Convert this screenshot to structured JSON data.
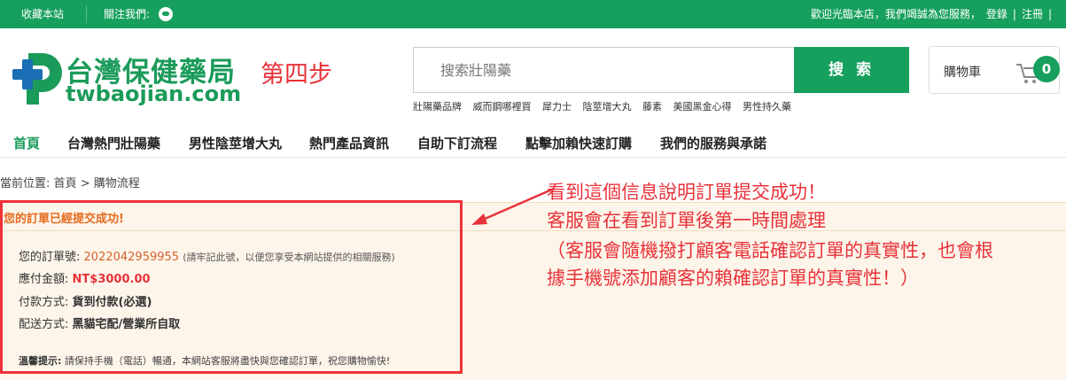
{
  "topbar": {
    "favorite": "收藏本站",
    "follow": "關注我們:",
    "welcome": "歡迎光臨本店，我們竭誠為您服務，",
    "login": "登錄",
    "sep": "|",
    "register": "注冊",
    "sep2": "|"
  },
  "logo": {
    "title": "台灣保健藥局",
    "subtitle": "twbaojian.com"
  },
  "step_label": "第四步",
  "search": {
    "placeholder": "搜索壯陽藥",
    "button": "搜 索"
  },
  "hotwords": [
    "壯陽藥品牌",
    "威而鋼哪裡買",
    "犀力士",
    "陰莖增大丸",
    "藤素",
    "美國黑金心得",
    "男性持久藥"
  ],
  "cart": {
    "label": "購物車",
    "count": "0"
  },
  "nav": [
    "首頁",
    "台灣熱門壯陽藥",
    "男性陰莖增大丸",
    "熱門產品資訊",
    "自助下訂流程",
    "點擊加賴快速訂購",
    "我們的服務與承諾"
  ],
  "breadcrumb": {
    "prefix": "當前位置:",
    "home": "首頁",
    "arrow": ">",
    "current": "購物流程"
  },
  "order": {
    "success": "您的訂單已經提交成功!",
    "number_label": "您的訂單號:",
    "number": "2022042959955",
    "number_note": "(請牢記此號，以便您享受本網站提供的相關服務)",
    "amount_label": "應付金額:",
    "amount": "NT$3000.00",
    "payment_label": "付款方式:",
    "payment": "貨到付款(必選)",
    "shipping_label": "配送方式:",
    "shipping": "黑貓宅配/營業所自取",
    "tip_label": "溫馨提示:",
    "tip": "請保持手機（電話）暢通，本網站客服將盡快與您確認訂單，祝您購物愉快!"
  },
  "annotation": {
    "line1": "看到這個信息說明訂單提交成功！",
    "line2": "客服會在看到訂單後第一時間處理",
    "line3": "（客服會隨機撥打顧客電話確認訂單的真實性，也會根",
    "line4": "據手機號添加顧客的賴確認訂單的真實性！）"
  },
  "colors": {
    "brand": "#17a05d",
    "accent_red": "#e8323a",
    "order_bg": "#fdf5ea"
  }
}
